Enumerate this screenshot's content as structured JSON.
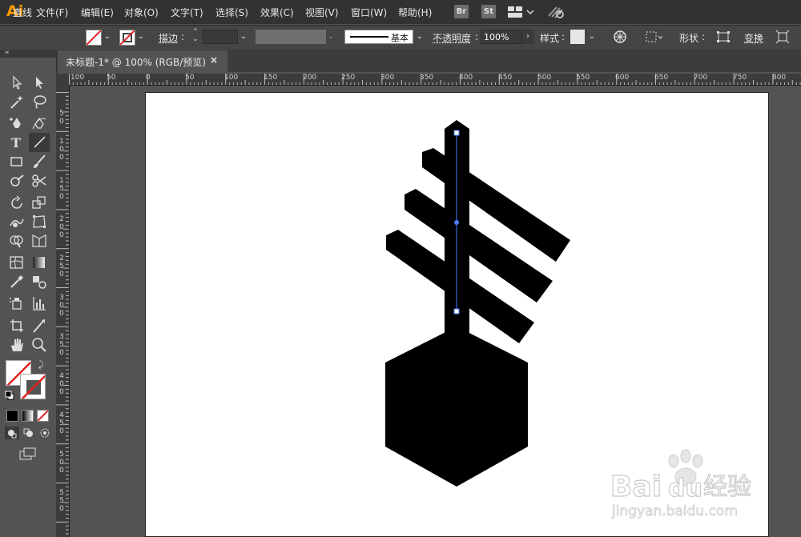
{
  "app": {
    "logo": "Ai"
  },
  "menu": [
    "文件(F)",
    "编辑(E)",
    "对象(O)",
    "文字(T)",
    "选择(S)",
    "效果(C)",
    "视图(V)",
    "窗口(W)",
    "帮助(H)"
  ],
  "app_badges": [
    "Br",
    "St"
  ],
  "control": {
    "selection_type": "直线",
    "stroke_label": "描边",
    "stroke_profile": "基本",
    "opacity_label": "不透明度",
    "opacity_value": "100%",
    "style_label": "样式",
    "shape_label": "形状",
    "transform_label": "变换"
  },
  "tab": {
    "title": "未标题-1* @ 100% (RGB/预览)",
    "close": "×"
  },
  "ruler_top": [
    "100",
    "50",
    "0",
    "50",
    "100",
    "150",
    "200",
    "250",
    "300",
    "350",
    "400",
    "450",
    "500",
    "550",
    "600",
    "650",
    "700",
    "750",
    "800"
  ],
  "ruler_left": [
    "5\n0",
    "1\n0\n0",
    "1\n5\n0",
    "2\n0\n0",
    "2\n5\n0",
    "3\n0\n0",
    "3\n5\n0",
    "4\n0\n0",
    "4\n5\n0",
    "5\n0\n0",
    "5\n5\n0"
  ],
  "watermark": {
    "brand": "Bai",
    "brand2": "du",
    "product": "经验",
    "url": "jingyan.baidu.com"
  },
  "colors": {
    "accent": "#ff9a00",
    "selection": "#4a7cff",
    "artwork": "#000000",
    "none_slash": "#e02020"
  },
  "tools": [
    "selection-tool",
    "direct-selection-tool",
    "magic-wand-tool",
    "lasso-tool",
    "pen-tool",
    "curvature-tool",
    "type-tool",
    "line-segment-tool",
    "rectangle-tool",
    "paintbrush-tool",
    "shaper-tool",
    "scissors-tool",
    "rotate-tool",
    "scale-tool",
    "warp-tool",
    "free-transform-tool",
    "shape-builder-tool",
    "perspective-grid-tool",
    "mesh-tool",
    "gradient-tool",
    "eyedropper-tool",
    "blend-tool",
    "symbol-sprayer-tool",
    "column-graph-tool",
    "artboard-tool",
    "slice-tool",
    "hand-tool",
    "zoom-tool"
  ]
}
